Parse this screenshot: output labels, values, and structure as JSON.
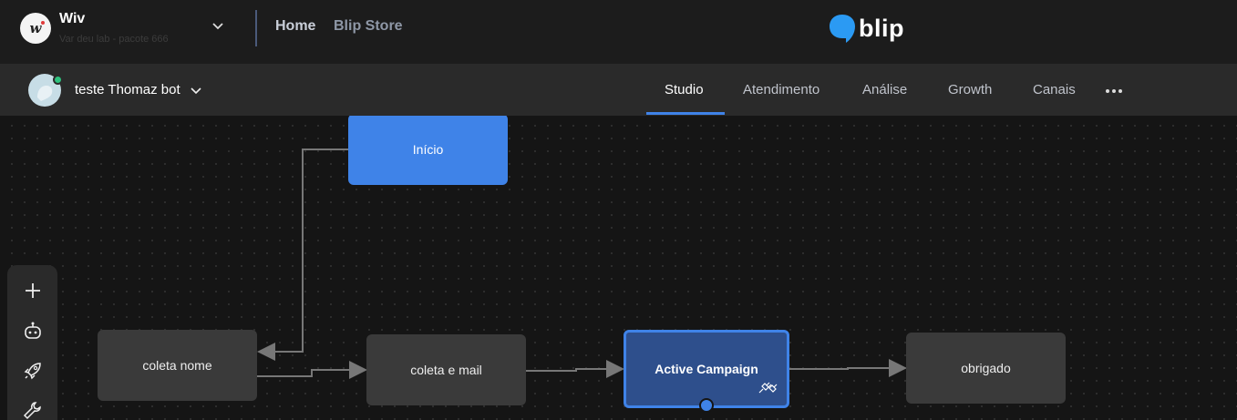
{
  "topbar": {
    "org": {
      "name": "Wiv",
      "subtitle": "Var deu lab - pacote 666",
      "logo_letter": "w"
    },
    "nav": {
      "home": "Home",
      "store": "Blip Store"
    },
    "brand": "blip"
  },
  "botbar": {
    "bot_name": "teste Thomaz bot",
    "status_color": "#2ec27e",
    "tabs": [
      "Studio",
      "Atendimento",
      "Análise",
      "Growth",
      "Canais"
    ],
    "active_tab": "Studio"
  },
  "flow": {
    "blocks": {
      "inicio": "Início",
      "coleta_nome": "coleta nome",
      "coleta_mail": "coleta e mail",
      "active_campaign": "Active Campaign",
      "obrigado": "obrigado"
    }
  },
  "toolbar": {
    "icons": [
      "plus-icon",
      "bot-icon",
      "rocket-icon",
      "wrench-icon"
    ]
  },
  "colors": {
    "accent": "#3f83e8",
    "block": "#3a3a3a",
    "selected_block": "#2e4f8c"
  }
}
